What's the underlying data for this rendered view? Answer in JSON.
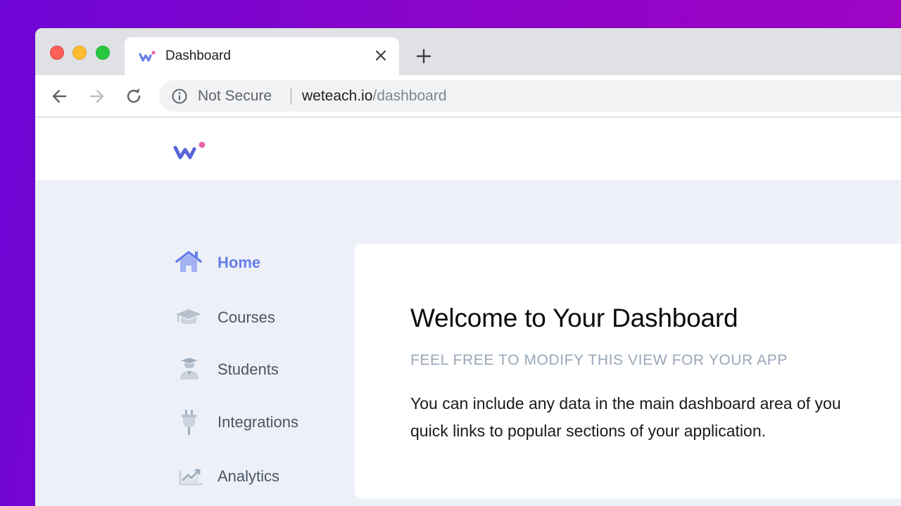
{
  "browser": {
    "tab": {
      "title": "Dashboard"
    },
    "address_bar": {
      "security_label": "Not Secure",
      "url_host": "weteach.io",
      "url_path": "/dashboard"
    }
  },
  "sidebar": {
    "items": [
      {
        "label": "Home",
        "icon": "home-icon",
        "active": true
      },
      {
        "label": "Courses",
        "icon": "graduation-cap-icon",
        "active": false
      },
      {
        "label": "Students",
        "icon": "student-icon",
        "active": false
      },
      {
        "label": "Integrations",
        "icon": "plug-icon",
        "active": false
      },
      {
        "label": "Analytics",
        "icon": "chart-icon",
        "active": false
      }
    ]
  },
  "main": {
    "title": "Welcome to Your Dashboard",
    "subtitle": "FEEL FREE TO MODIFY THIS VIEW FOR YOUR APP",
    "body_line1": "You can include any data in the main dashboard area of you",
    "body_line2": "quick links to popular sections of your application."
  },
  "colors": {
    "accent": "#667eea",
    "logo_dot": "#ed64a6",
    "nav_text": "#4a5568",
    "page_background": "#edf1f7",
    "subtitle": "#9aa7b8"
  }
}
